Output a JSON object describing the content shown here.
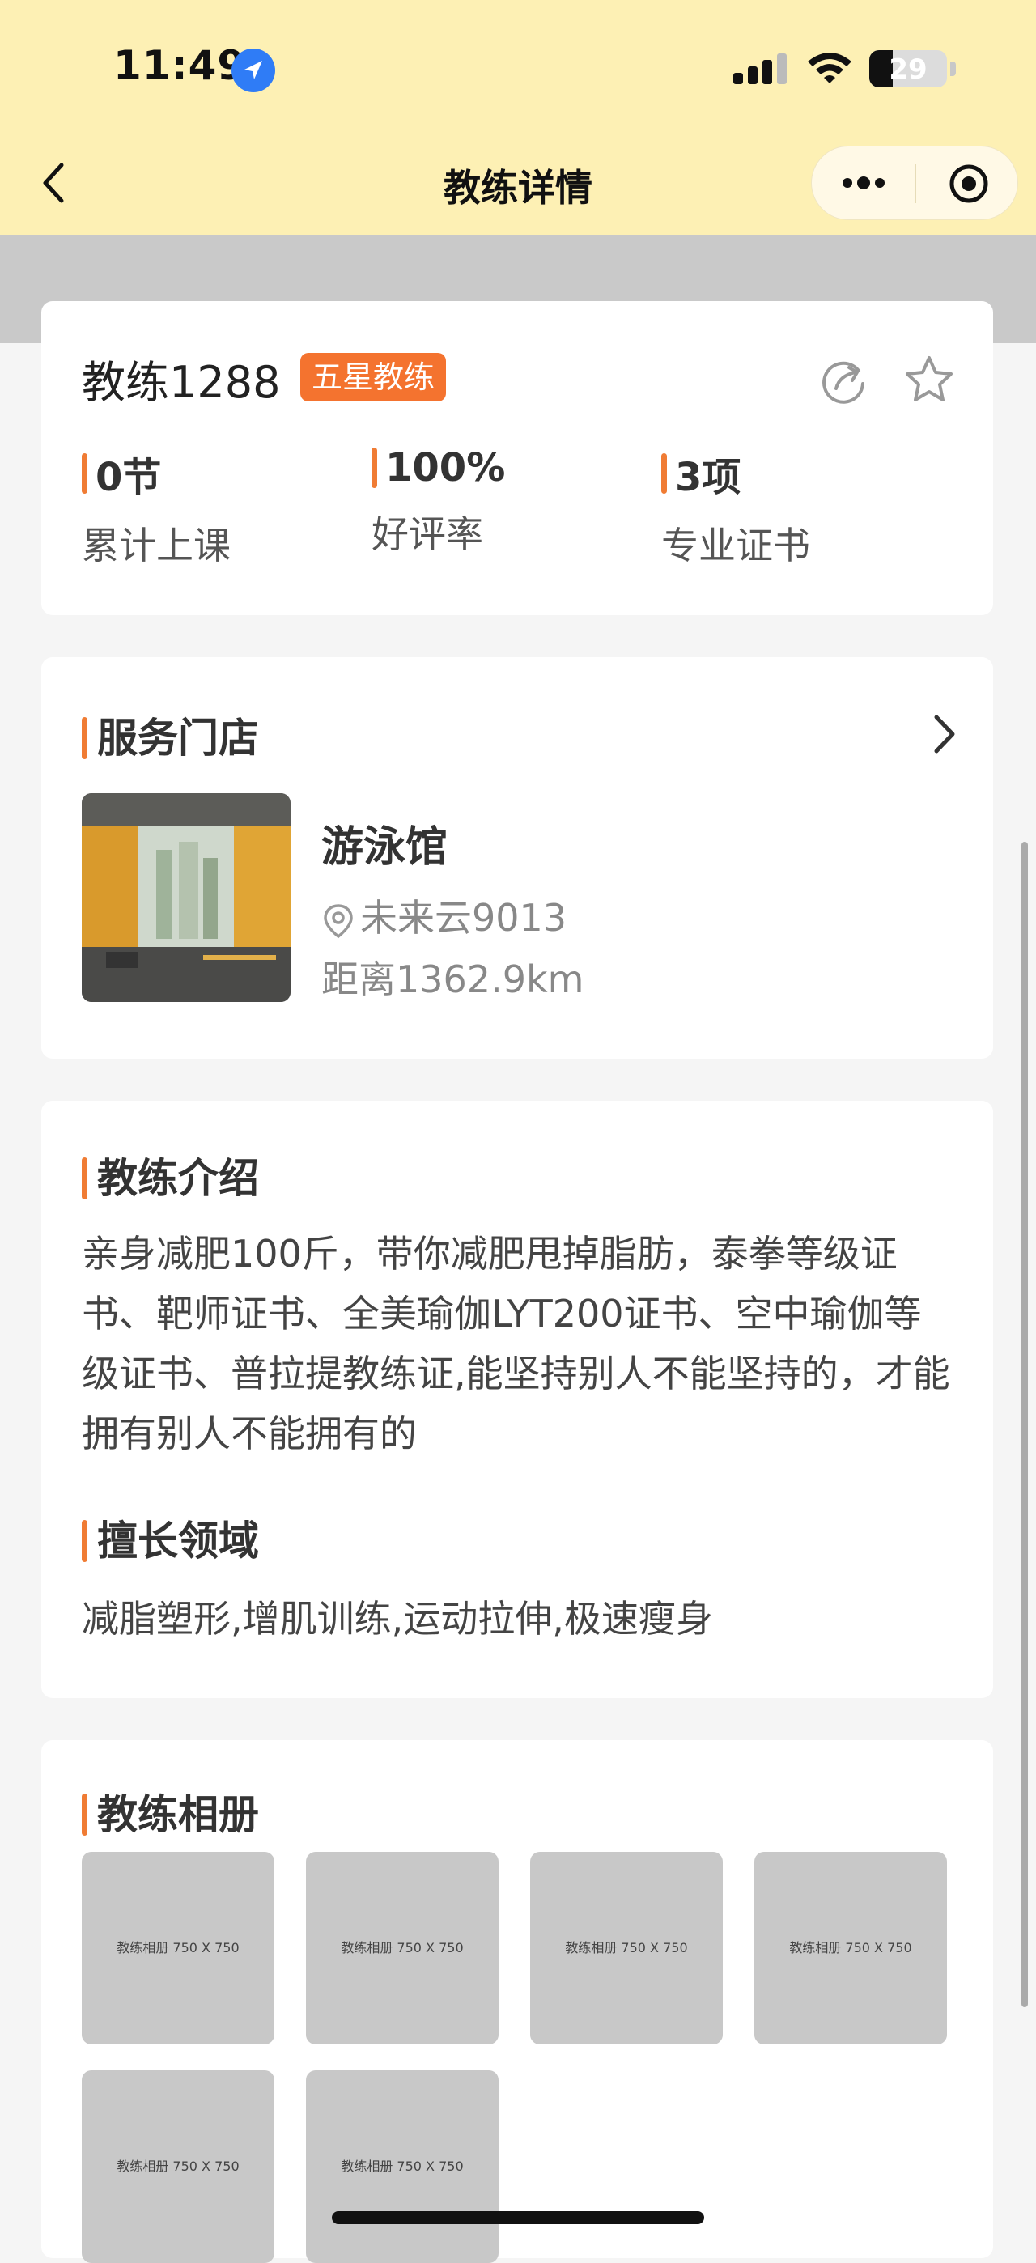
{
  "status_bar": {
    "time": "11:49",
    "battery": "29",
    "icons": [
      "location-arrow-icon",
      "cellular-signal-icon",
      "wifi-icon",
      "battery-icon"
    ]
  },
  "nav": {
    "title": "教练详情",
    "icons": [
      "back-chevron-icon",
      "more-dots-icon",
      "close-target-icon"
    ]
  },
  "coach": {
    "name": "教练1288",
    "badge": "五星教练",
    "stats": [
      {
        "value": "0节",
        "label": "累计上课"
      },
      {
        "value": "100%",
        "label": "好评率"
      },
      {
        "value": "3项",
        "label": "专业证书"
      }
    ],
    "icons": [
      "share-icon",
      "star-icon"
    ]
  },
  "store": {
    "section_title": "服务门店",
    "name": "游泳馆",
    "address": "未来云9013",
    "distance": "距离1362.9km",
    "icons": [
      "location-pin-icon",
      "chevron-right-icon"
    ]
  },
  "intro": {
    "section_title": "教练介绍",
    "text": "亲身减肥100斤，带你减肥甩掉脂肪，泰拳等级证书、靶师证书、全美瑜伽LYT200证书、空中瑜伽等级证书、普拉提教练证,能坚持别人不能坚持的，才能拥有别人不能拥有的",
    "skills_title": "擅长领域",
    "skills": "减脂塑形,增肌训练,运动拉伸,极速瘦身"
  },
  "album": {
    "section_title": "教练相册",
    "items": [
      "教练相册 750 X 750",
      "教练相册 750 X 750",
      "教练相册 750 X 750",
      "教练相册 750 X 750",
      "教练相册 750 X 750",
      "教练相册 750 X 750"
    ]
  },
  "colors": {
    "accent": "#f07c34",
    "nav_bg": "#fdf0b4",
    "badge_bg": "#f4732f"
  }
}
